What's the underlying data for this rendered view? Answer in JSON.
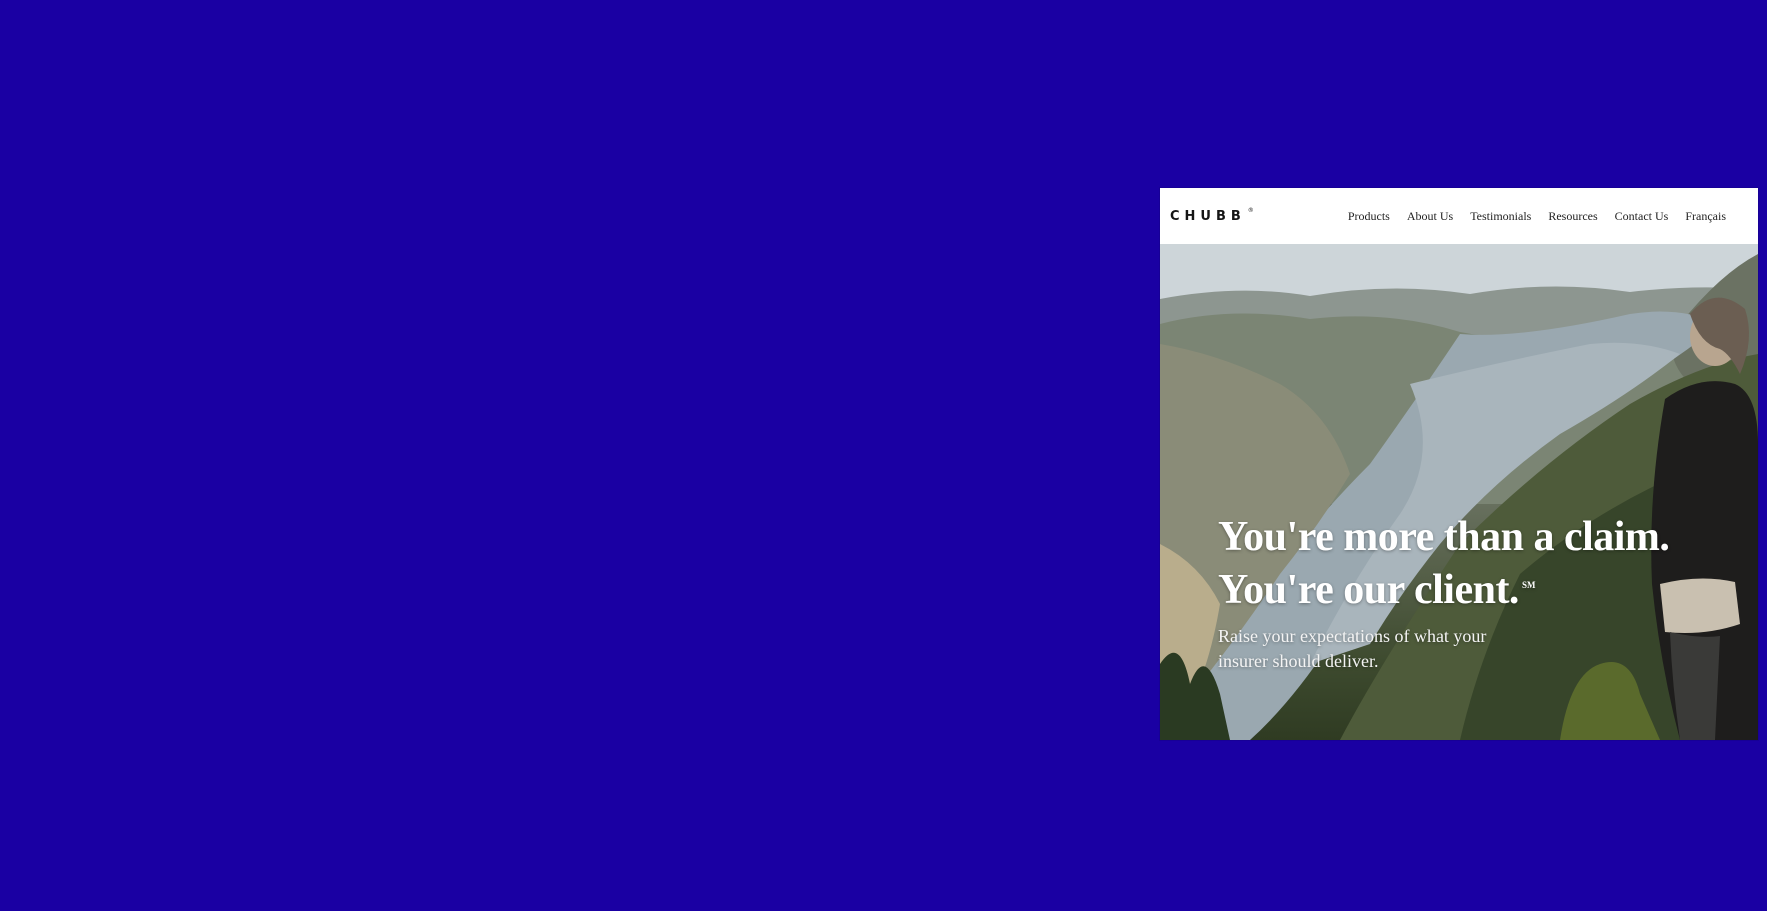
{
  "header": {
    "logo_text": "CHUBB",
    "logo_mark": "®",
    "nav": [
      "Products",
      "About Us",
      "Testimonials",
      "Resources",
      "Contact Us",
      "Français"
    ]
  },
  "hero": {
    "heading_line_1": "You're more than a claim.",
    "heading_line_2": "You're our client.",
    "service_mark": "SM",
    "subheading": "Raise your expectations of what your insurer should deliver."
  },
  "colors": {
    "backdrop": "#1a00a3",
    "header_bg": "#ffffff",
    "hero_text": "#ffffff"
  }
}
